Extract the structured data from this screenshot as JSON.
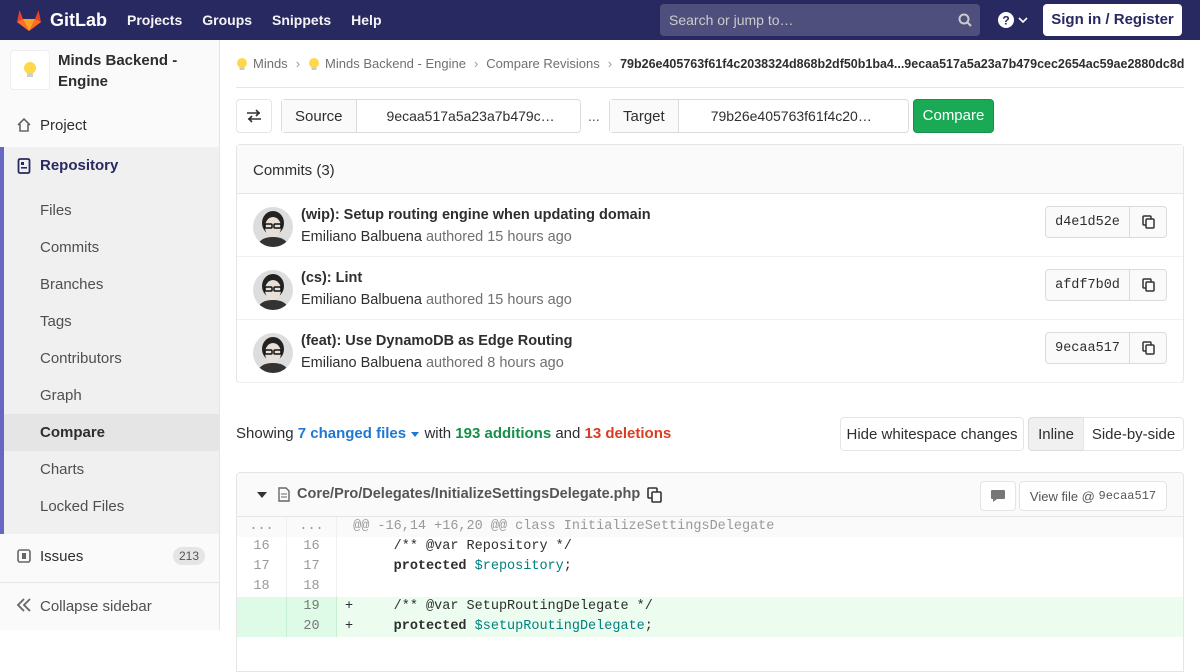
{
  "topbar": {
    "brand": "GitLab",
    "nav": [
      "Projects",
      "Groups",
      "Snippets",
      "Help"
    ],
    "search_placeholder": "Search or jump to…",
    "signin": "Sign in / Register"
  },
  "sidebar": {
    "project_name": "Minds Backend - Engine",
    "project": "Project",
    "repository": "Repository",
    "repo_items": [
      "Files",
      "Commits",
      "Branches",
      "Tags",
      "Contributors",
      "Graph",
      "Compare",
      "Charts",
      "Locked Files"
    ],
    "issues": "Issues",
    "issues_count": "213",
    "collapse": "Collapse sidebar"
  },
  "breadcrumb": [
    "Minds",
    "Minds Backend - Engine",
    "Compare Revisions",
    "79b26e405763f61f4c2038324d868b2df50b1ba4...9ecaa517a5a23a7b479cec2654ac59ae2880dc8d"
  ],
  "compare": {
    "source_label": "Source",
    "source_value": "9ecaa517a5a23a7b479c…",
    "ellipsis": "...",
    "target_label": "Target",
    "target_value": "79b26e405763f61f4c20…",
    "compare_button": "Compare"
  },
  "commits": {
    "header": "Commits (3)",
    "items": [
      {
        "title": "(wip): Setup routing engine when updating domain",
        "author": "Emiliano Balbuena",
        "meta": "authored 15 hours ago",
        "sha": "d4e1d52e"
      },
      {
        "title": "(cs): Lint",
        "author": "Emiliano Balbuena",
        "meta": "authored 15 hours ago",
        "sha": "afdf7b0d"
      },
      {
        "title": "(feat): Use DynamoDB as Edge Routing",
        "author": "Emiliano Balbuena",
        "meta": "authored 8 hours ago",
        "sha": "9ecaa517"
      }
    ]
  },
  "diffstats": {
    "showing": "Showing",
    "changed": "7 changed files",
    "with": "with",
    "additions": "193 additions",
    "and": "and",
    "deletions": "13 deletions",
    "hide_ws": "Hide whitespace changes",
    "inline": "Inline",
    "side": "Side-by-side"
  },
  "file": {
    "path": "Core/Pro/Delegates/InitializeSettingsDelegate.php",
    "view_file": "View file @",
    "view_sha": "9ecaa517",
    "lines": [
      {
        "o": "...",
        "n": "...",
        "s": "",
        "t": "@@ -16,14 +16,20 @@ class InitializeSettingsDelegate",
        "k": "meta"
      },
      {
        "o": "16",
        "n": "16",
        "s": " ",
        "t": "    /** @var Repository */",
        "k": "ctx"
      },
      {
        "o": "17",
        "n": "17",
        "s": " ",
        "t": "    protected ",
        "v": "$repository",
        "e": ";",
        "k": "ctx"
      },
      {
        "o": "18",
        "n": "18",
        "s": " ",
        "t": "",
        "k": "ctx"
      },
      {
        "o": "",
        "n": "19",
        "s": "+",
        "t": "    /** @var SetupRoutingDelegate */",
        "k": "add"
      },
      {
        "o": "",
        "n": "20",
        "s": "+",
        "t": "    protected ",
        "v": "$setupRoutingDelegate",
        "e": ";",
        "k": "add"
      }
    ]
  }
}
